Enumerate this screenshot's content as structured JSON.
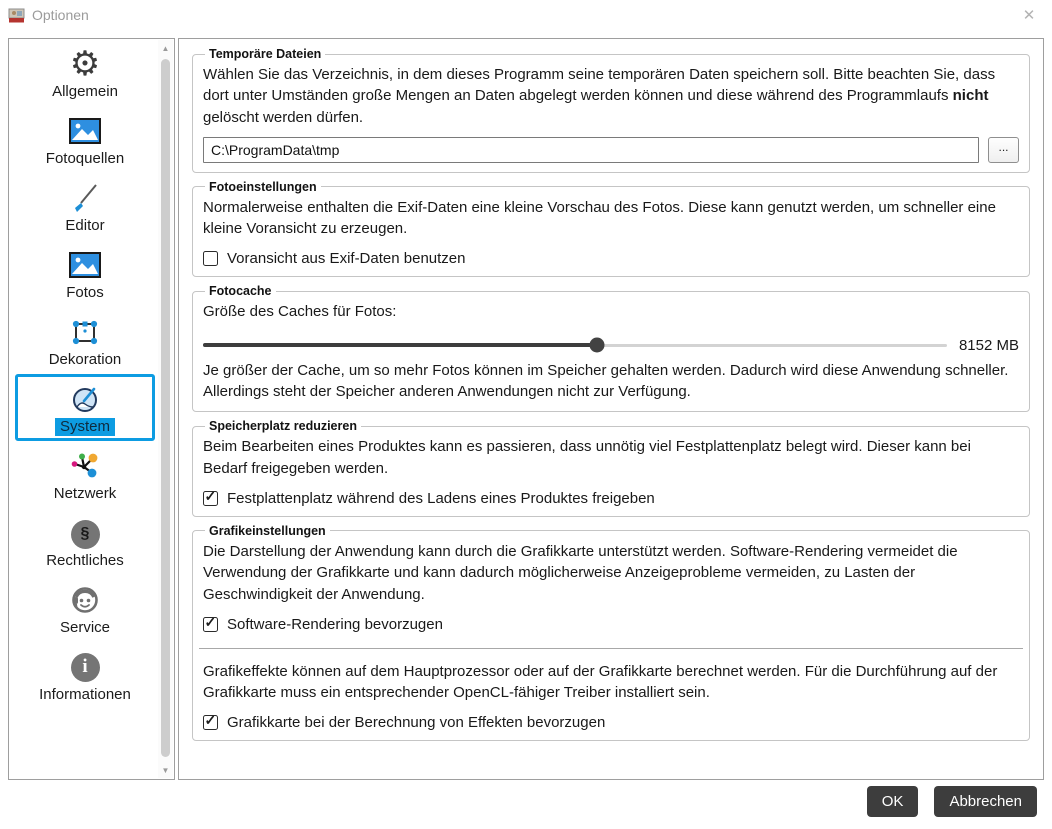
{
  "window": {
    "title": "Optionen",
    "close": "✕"
  },
  "sidebar": {
    "items": [
      {
        "label": "Allgemein"
      },
      {
        "label": "Fotoquellen"
      },
      {
        "label": "Editor"
      },
      {
        "label": "Fotos"
      },
      {
        "label": "Dekoration"
      },
      {
        "label": "System",
        "selected": true
      },
      {
        "label": "Netzwerk"
      },
      {
        "label": "Rechtliches"
      },
      {
        "label": "Service"
      },
      {
        "label": "Informationen"
      }
    ]
  },
  "sections": {
    "temp": {
      "legend": "Temporäre Dateien",
      "text_pre": "Wählen Sie das Verzeichnis, in dem dieses Programm seine temporären Daten speichern soll. Bitte beachten Sie, dass dort unter Umständen große Mengen an Daten abgelegt werden können und diese während des Programmlaufs ",
      "text_bold": "nicht",
      "text_post": " gelöscht werden dürfen.",
      "path": "C:\\ProgramData\\tmp",
      "browse": "..."
    },
    "foto": {
      "legend": "Fotoeinstellungen",
      "text": "Normalerweise enthalten die Exif-Daten eine kleine Vorschau des Fotos. Diese kann genutzt werden, um schneller eine kleine Voransicht zu erzeugen.",
      "checkbox": "Voransicht aus Exif-Daten benutzen",
      "checked": false
    },
    "cache": {
      "legend": "Fotocache",
      "label": "Größe des Caches für Fotos:",
      "value": "8152 MB",
      "percent": 53,
      "text": "Je größer der Cache, um so mehr Fotos können im Speicher gehalten werden. Dadurch wird diese Anwendung schneller. Allerdings steht der Speicher anderen Anwendungen nicht zur Verfügung."
    },
    "disk": {
      "legend": "Speicherplatz reduzieren",
      "text": "Beim Bearbeiten eines Produktes kann es passieren, dass unnötig viel Festplattenplatz belegt wird. Dieser kann bei Bedarf freigegeben werden.",
      "checkbox": "Festplattenplatz während des Ladens eines Produktes freigeben",
      "checked": true
    },
    "gfx": {
      "legend": "Grafikeinstellungen",
      "text1": "Die Darstellung der Anwendung kann durch die Grafikkarte unterstützt werden. Software-Rendering vermeidet die Verwendung der Grafikkarte und kann dadurch möglicherweise Anzeigeprobleme vermeiden, zu Lasten der Geschwindigkeit der Anwendung.",
      "checkbox1": "Software-Rendering bevorzugen",
      "checked1": true,
      "text2": "Grafikeffekte können auf dem Hauptprozessor oder auf der Grafikkarte berechnet werden. Für die Durchführung auf der Grafikkarte muss ein entsprechender OpenCL-fähiger Treiber installiert sein.",
      "checkbox2": "Grafikkarte bei der Berechnung von Effekten bevorzugen",
      "checked2": true
    }
  },
  "footer": {
    "ok": "OK",
    "cancel": "Abbrechen"
  },
  "colors": {
    "accent": "#0d9ce2",
    "button_bg": "#3d3d3d"
  }
}
